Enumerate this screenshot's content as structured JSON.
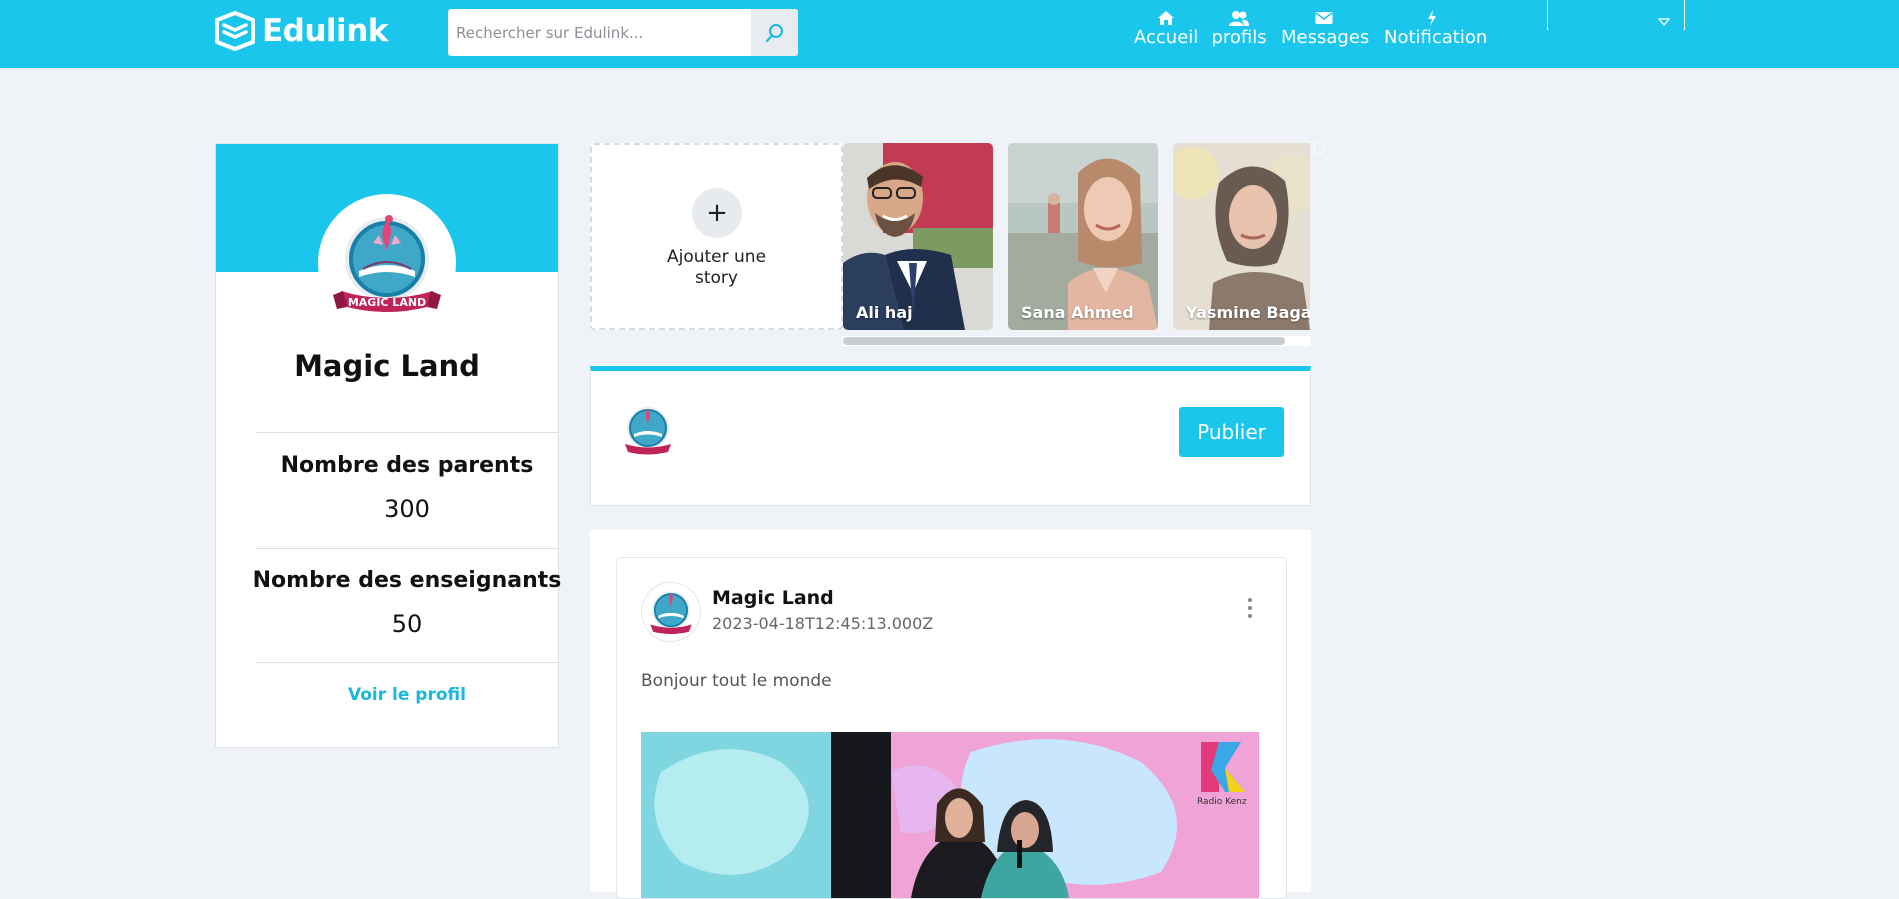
{
  "header": {
    "logo_text": "Edulink",
    "search": {
      "placeholder": "Rechercher sur Edulink..."
    },
    "nav": [
      {
        "label": "Accueil",
        "icon": "home-icon"
      },
      {
        "label": "profils",
        "icon": "users-icon"
      },
      {
        "label": "Messages",
        "icon": "envelope-icon"
      },
      {
        "label": "Notification",
        "icon": "bolt-icon"
      }
    ],
    "dropdown_icon": "caret-down-icon"
  },
  "profile": {
    "name": "Magic Land",
    "logo_text": "MAGIC LAND",
    "stats": [
      {
        "label": "Nombre des parents",
        "value": "300"
      },
      {
        "label": "Nombre des enseignants",
        "value": "50"
      }
    ],
    "link_label": "Voir le profil"
  },
  "stories": {
    "add_label": "Ajouter une story",
    "items": [
      {
        "name": "Ali haj"
      },
      {
        "name": "Sana Ahmed"
      },
      {
        "name": "Yasmine Bagane"
      }
    ]
  },
  "publisher": {
    "button_label": "Publier"
  },
  "post": {
    "author": "Magic Land",
    "date": "2023-04-18T12:45:13.000Z",
    "text": "Bonjour tout le monde",
    "image_watermark": "Radio Kenz"
  },
  "colors": {
    "brand": "#1ac6ec",
    "page_bg": "#eff2f6",
    "link": "#1ab8dd"
  }
}
